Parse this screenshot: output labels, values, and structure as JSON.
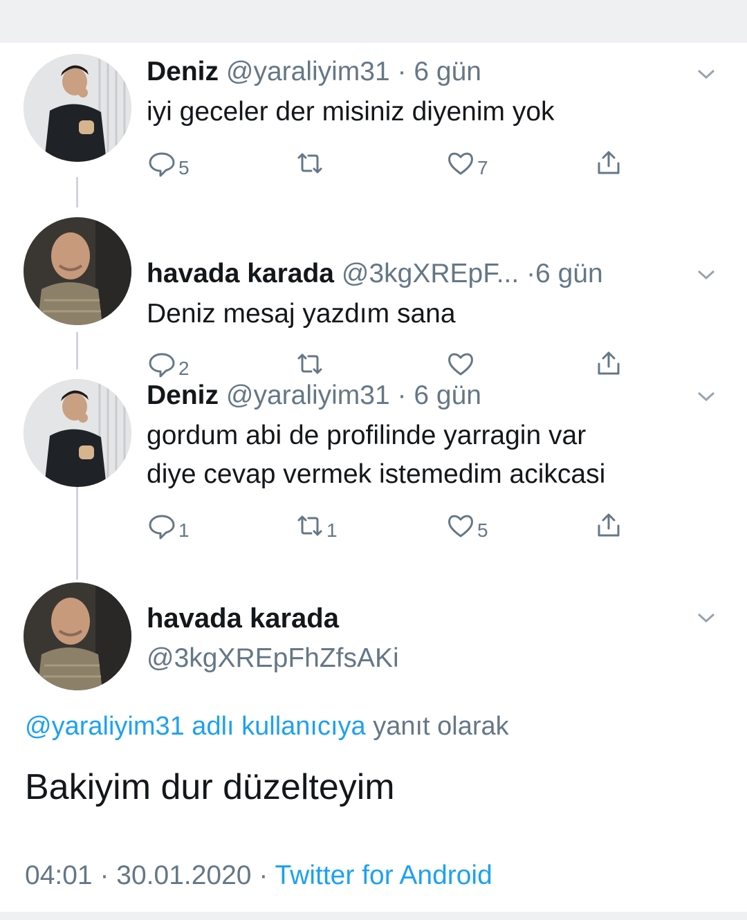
{
  "tweets": [
    {
      "name": "Deniz",
      "handle": "@yaraliyim31",
      "time": "· 6 gün",
      "text_lines": [
        "iyi geceler der misiniz diyenim yok"
      ],
      "reply_count": "5",
      "retweet_count": "",
      "like_count": "7"
    },
    {
      "name": "havada karada",
      "handle": "@3kgXREpF...",
      "time": "·6 gün",
      "text_lines": [
        "Deniz mesaj yazdım sana"
      ],
      "reply_count": "2",
      "retweet_count": "",
      "like_count": ""
    },
    {
      "name": "Deniz",
      "handle": "@yaraliyim31",
      "time": "· 6 gün",
      "text_lines": [
        "gordum abi de profilinde yarragin var",
        "diye cevap vermek istemedim acikcasi"
      ],
      "reply_count": "1",
      "retweet_count": "1",
      "like_count": "5"
    }
  ],
  "focus": {
    "name": "havada karada",
    "handle": "@3kgXREpFhZfsAKi",
    "reply_to_link": "@yaraliyim31 adlı kullanıcıya",
    "reply_to_suffix": "yanıt olarak",
    "text": "Bakiyim dur düzelteyim",
    "time": "04:01",
    "date": "30.01.2020",
    "separator": "·",
    "source": "Twitter for Android"
  },
  "icons": {
    "reply": "reply-icon",
    "retweet": "retweet-icon",
    "like": "heart-icon",
    "share": "share-icon",
    "menu": "chevron-down-icon"
  },
  "colors": {
    "accent": "#1da1f2",
    "muted": "#657786",
    "text": "#14171a"
  }
}
